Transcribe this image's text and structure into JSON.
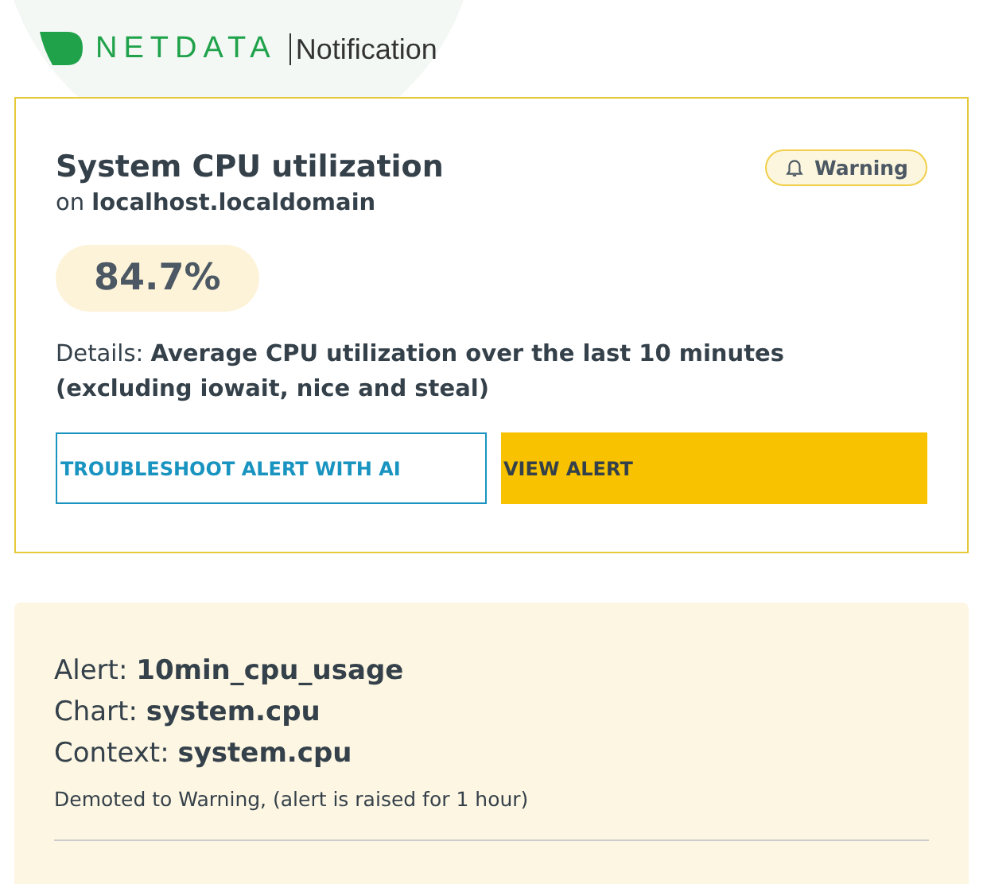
{
  "header": {
    "brand": "NETDATA",
    "subtitle": "Notification"
  },
  "alert_card": {
    "title": "System CPU utilization",
    "host": "on **localhost.localdomain**",
    "badge": {
      "label": "Warning",
      "kind": "warning"
    },
    "value": "84.7%",
    "details": "Details: **Average CPU utilization over the last 10 minutes (excluding iowait, nice and steal)**",
    "buttons": [
      {
        "label": "TROUBLESHOOT ALERT WITH AI",
        "kind": "outline"
      },
      {
        "label": "VIEW ALERT",
        "kind": "primary"
      }
    ]
  },
  "info": {
    "lines": [
      "Alert: **10min_cpu_usage**",
      "Chart: **system.cpu**",
      "Context: **system.cpu**"
    ],
    "note": "Demoted to Warning, (alert is raised for 1 hour)"
  }
}
